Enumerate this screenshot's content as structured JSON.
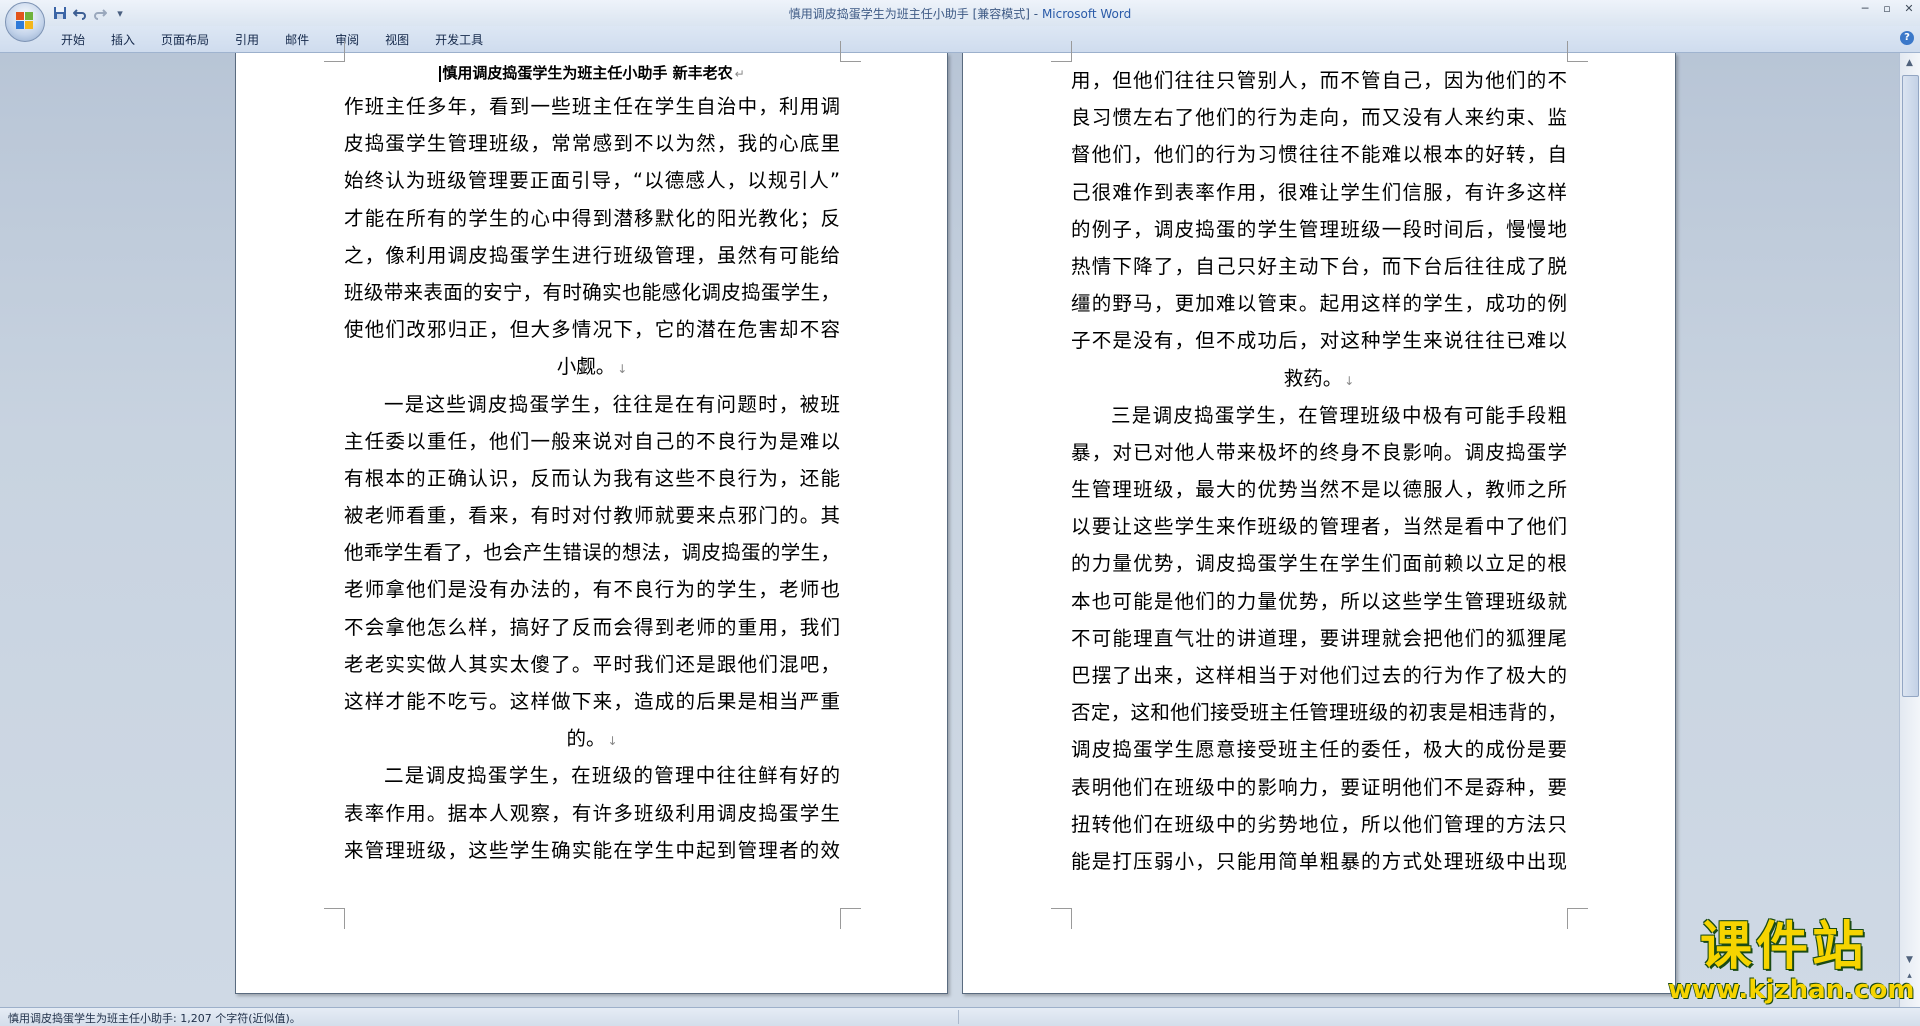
{
  "window": {
    "doc_name": "慎用调皮捣蛋学生为班主任小助手 [兼容模式]",
    "separator": " - ",
    "app_name": "Microsoft Word",
    "controls": [
      "─",
      "▫",
      "✕"
    ]
  },
  "quick_access": {
    "save_icon": "save-icon",
    "undo_icon": "undo-icon",
    "redo_icon": "redo-icon",
    "customize_icon": "dropdown-icon"
  },
  "ribbon": {
    "tabs": [
      "开始",
      "插入",
      "页面布局",
      "引用",
      "邮件",
      "审阅",
      "视图",
      "开发工具"
    ],
    "help": "?"
  },
  "document": {
    "title": "慎用调皮捣蛋学生为班主任小助手  新丰老农",
    "page1_lines": [
      "作班主任多年，看到一些班主任在学生自治中，利用调",
      "皮捣蛋学生管理班级，常常感到不以为然，我的心底里",
      "始终认为班级管理要正面引导，“以德感人，以规引人”",
      "才能在所有的学生的心中得到潜移默化的阳光教化；反",
      "之，像利用调皮捣蛋学生进行班级管理，虽然有可能给",
      "班级带来表面的安宁，有时确实也能感化调皮捣蛋学生，",
      "使他们改邪归正，但大多情况下，它的潜在危害却不容",
      "小觑。",
      "一是这些调皮捣蛋学生，往往是在有问题时，被班",
      "主任委以重任，他们一般来说对自己的不良行为是难以",
      "有根本的正确认识，反而认为我有这些不良行为，还能",
      "被老师看重，看来，有时对付教师就要来点邪门的。其",
      "他乖学生看了，也会产生错误的想法，调皮捣蛋的学生，",
      "老师拿他们是没有办法的，有不良行为的学生，老师也",
      "不会拿他怎么样，搞好了反而会得到老师的重用，我们",
      "老老实实做人其实太傻了。平时我们还是跟他们混吧，",
      "这样才能不吃亏。这样做下来，造成的后果是相当严重",
      "的。",
      "二是调皮捣蛋学生，在班级的管理中往往鲜有好的",
      "表率作用。据本人观察，有许多班级利用调皮捣蛋学生",
      "来管理班级，这些学生确实能在学生中起到管理者的效"
    ],
    "page2_lines": [
      "用，但他们往往只管别人，而不管自己，因为他们的不",
      "良习惯左右了他们的行为走向，而又没有人来约束、监",
      "督他们，他们的行为习惯往往不能难以根本的好转，自",
      "己很难作到表率作用，很难让学生们信服，有许多这样",
      "的例子，调皮捣蛋的学生管理班级一段时间后，慢慢地",
      "热情下降了，自己只好主动下台，而下台后往往成了脱",
      "缰的野马，更加难以管束。起用这样的学生，成功的例",
      "子不是没有，但不成功后，对这种学生来说往往已难以",
      "救药。",
      "三是调皮捣蛋学生，在管理班级中极有可能手段粗",
      "暴，对已对他人带来极坏的终身不良影响。调皮捣蛋学",
      "生管理班级，最大的优势当然不是以德服人，教师之所",
      "以要让这些学生来作班级的管理者，当然是看中了他们",
      "的力量优势，调皮捣蛋学生在学生们面前赖以立足的根",
      "本也可能是他们的力量优势，所以这些学生管理班级就",
      "不可能理直气壮的讲道理，要讲理就会把他们的狐狸尾",
      "巴摆了出来，这样相当于对他们过去的行为作了极大的",
      "否定，这和他们接受班主任管理班级的初衷是相违背的，",
      "调皮捣蛋学生愿意接受班主任的委任，极大的成份是要",
      "表明他们在班级中的影响力，要证明他们不是孬种，要",
      "扭转他们在班级中的劣势地位，所以他们管理的方法只",
      "能是打压弱小，只能用简单粗暴的方式处理班级中出现"
    ],
    "paragraph_mark": "↓",
    "title_mark": "↵"
  },
  "statusbar": {
    "text": "慎用调皮捣蛋学生为班主任小助手: 1,207 个字符(近似值)。"
  },
  "watermark": {
    "cn": "课件站",
    "en": "www.kjzhan.com"
  },
  "colors": {
    "title_app": "#2a5aa8",
    "watermark_fill": "#f6d400",
    "watermark_outline": "#1a4a14"
  }
}
